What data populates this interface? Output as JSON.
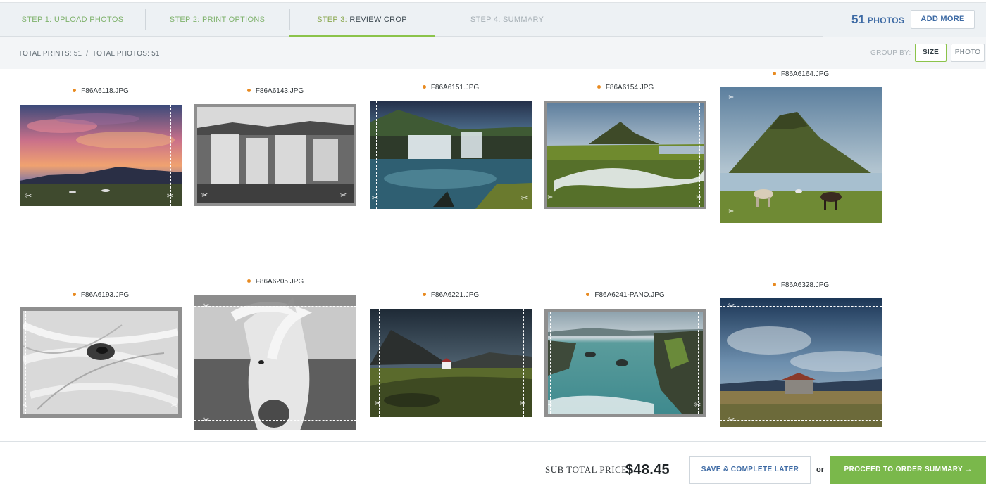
{
  "steps": [
    {
      "prefix": "STEP 1:",
      "label": "UPLOAD PHOTOS"
    },
    {
      "prefix": "STEP 2:",
      "label": "PRINT OPTIONS"
    },
    {
      "prefix": "STEP 3:",
      "label": "REVIEW CROP"
    },
    {
      "prefix": "STEP 4:",
      "label": "SUMMARY"
    }
  ],
  "header": {
    "photo_count": "51",
    "photo_label": "PHOTOS",
    "add_more_label": "ADD MORE"
  },
  "toolbar": {
    "totals": "TOTAL PRINTS: 51  /  TOTAL PHOTOS: 51",
    "group_by_label": "GROUP BY:",
    "group_size_label": "SIZE",
    "group_photo_label": "PHOTO"
  },
  "photos": [
    {
      "filename": "F86A6118.JPG"
    },
    {
      "filename": "F86A6143.JPG"
    },
    {
      "filename": "F86A6151.JPG"
    },
    {
      "filename": "F86A6154.JPG"
    },
    {
      "filename": "F86A6164.JPG"
    },
    {
      "filename": "F86A6193.JPG"
    },
    {
      "filename": "F86A6205.JPG"
    },
    {
      "filename": "F86A6221.JPG"
    },
    {
      "filename": "F86A6241-PANO.JPG"
    },
    {
      "filename": "F86A6328.JPG"
    }
  ],
  "footer": {
    "subtotal_label": "SUB TOTAL PRICE",
    "subtotal_value": "$48.45",
    "save_label": "SAVE & COMPLETE LATER",
    "or_label": "or",
    "proceed_label": "PROCEED TO ORDER SUMMARY  →"
  },
  "colors": {
    "accent_green": "#8bc34a",
    "link_blue": "#3d6aa4",
    "status_dot": "#e88a20"
  },
  "icons": [
    "scissors-icon",
    "arrow-right-icon",
    "status-dot-icon"
  ]
}
